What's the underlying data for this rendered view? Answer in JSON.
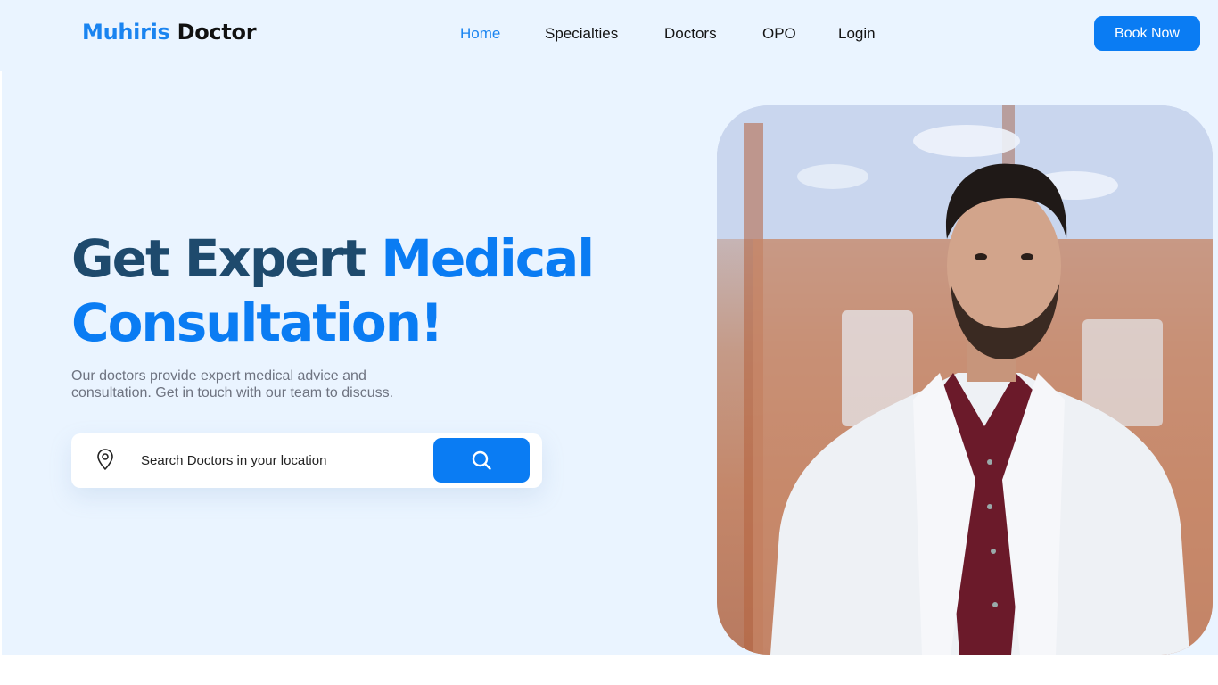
{
  "header": {
    "logo_part1": "Muhiris",
    "logo_part2": "Doctor",
    "nav": [
      {
        "label": "Home",
        "active": true
      },
      {
        "label": "Specialties",
        "active": false
      },
      {
        "label": "Doctors",
        "active": false
      },
      {
        "label": "OPO",
        "active": false
      },
      {
        "label": "Login",
        "active": false
      }
    ],
    "book_label": "Book Now"
  },
  "hero": {
    "headline_dark": "Get Expert",
    "headline_blue_1": "Medical",
    "headline_blue_2": "Consultation!",
    "subtext": "Our doctors provide expert medical advice and consultation. Get in touch with our team to discuss.",
    "search": {
      "placeholder": "Search Doctors in your location",
      "location_icon": "map-pin-icon",
      "button_icon": "search-icon"
    },
    "image": {
      "subject": "doctor-portrait"
    }
  },
  "colors": {
    "accent": "#0a7cf3",
    "headline_dark": "#1e4a6d",
    "hero_bg": "#eaf4ff"
  }
}
